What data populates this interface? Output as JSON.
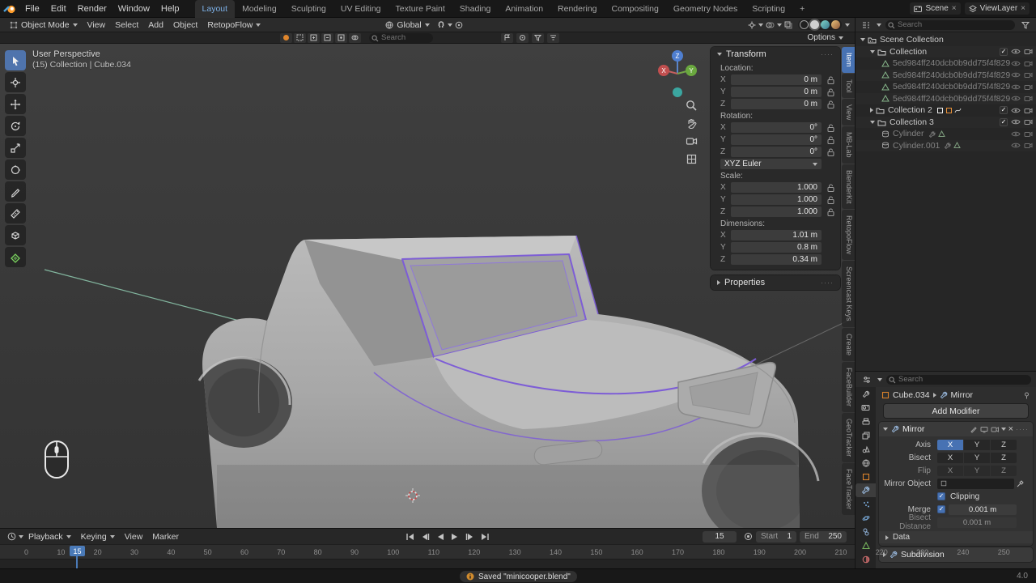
{
  "icons": {
    "close": "×",
    "check": "✓",
    "dots": "····"
  },
  "axes": {
    "x": "X",
    "y": "Y",
    "z": "Z"
  },
  "topbar": {
    "menus": [
      "File",
      "Edit",
      "Render",
      "Window",
      "Help"
    ],
    "workspaces": [
      "Layout",
      "Modeling",
      "Sculpting",
      "UV Editing",
      "Texture Paint",
      "Shading",
      "Animation",
      "Rendering",
      "Compositing",
      "Geometry Nodes",
      "Scripting"
    ],
    "add_tab": "+",
    "scene_label": "Scene",
    "viewlayer_label": "ViewLayer"
  },
  "viewport_header": {
    "mode": "Object Mode",
    "menus": [
      "View",
      "Select",
      "Add",
      "Object"
    ],
    "retopoflow": "RetopoFlow",
    "orientation": "Global",
    "search_placeholder": "Search",
    "options": "Options"
  },
  "viewport": {
    "view_label": "User Perspective",
    "context_label": "(15) Collection | Cube.034"
  },
  "sidebar": {
    "tabs": {
      "item": "Item",
      "tool": "Tool",
      "view": "View",
      "mblab": "MB-Lab",
      "blenderkit": "BlenderKit",
      "retopoflow": "RetopoFlow",
      "screencast": "Screencast Keys",
      "create": "Create",
      "facebuilder": "FaceBuilder",
      "geotracker": "GeoTracker",
      "facetracker": "FaceTracker"
    },
    "transform": {
      "title": "Transform",
      "location_label": "Location:",
      "loc_x": "0 m",
      "loc_y": "0 m",
      "loc_z": "0 m",
      "rotation_label": "Rotation:",
      "rot_x": "0°",
      "rot_y": "0°",
      "rot_z": "0°",
      "rotation_mode": "XYZ Euler",
      "scale_label": "Scale:",
      "scl_x": "1.000",
      "scl_y": "1.000",
      "scl_z": "1.000",
      "dimensions_label": "Dimensions:",
      "dim_x": "1.01 m",
      "dim_y": "0.8 m",
      "dim_z": "0.34 m"
    },
    "properties_title": "Properties"
  },
  "outliner": {
    "search_placeholder": "Search",
    "scene_collection": "Scene Collection",
    "collection1": "Collection",
    "hex_name": "5ed984ff240dcb0b9dd75f4f829",
    "collection2": "Collection 2",
    "collection3": "Collection 3",
    "cylinder": "Cylinder",
    "cylinder_001": "Cylinder.001"
  },
  "properties": {
    "search_placeholder": "Search",
    "breadcrumb_object": "Cube.034",
    "breadcrumb_modifier": "Mirror",
    "add_modifier_label": "Add Modifier",
    "mirror": {
      "title": "Mirror",
      "axis_label": "Axis",
      "bisect_label": "Bisect",
      "flip_label": "Flip",
      "mirror_object_label": "Mirror Object",
      "clipping_label": "Clipping",
      "merge_label": "Merge",
      "merge_value": "0.001 m",
      "bisect_distance_label": "Bisect Distance",
      "bisect_distance_value": "0.001 m",
      "data_label": "Data"
    },
    "next_modifier_title": "Subdivision"
  },
  "timeline": {
    "menus": [
      "Playback",
      "Keying",
      "View",
      "Marker"
    ],
    "current_frame": "15",
    "playhead_label": "15",
    "start_label": "Start",
    "start_value": "1",
    "end_label": "End",
    "end_value": "250",
    "ruler_ticks": [
      "0",
      "10",
      "20",
      "30",
      "40",
      "50",
      "60",
      "70",
      "80",
      "90",
      "100",
      "110",
      "120",
      "130",
      "140",
      "150",
      "160",
      "170",
      "180",
      "190",
      "200",
      "210",
      "220",
      "230",
      "240",
      "250"
    ]
  },
  "statusbar": {
    "message": "Saved \"minicooper.blend\"",
    "version": "4.0"
  }
}
